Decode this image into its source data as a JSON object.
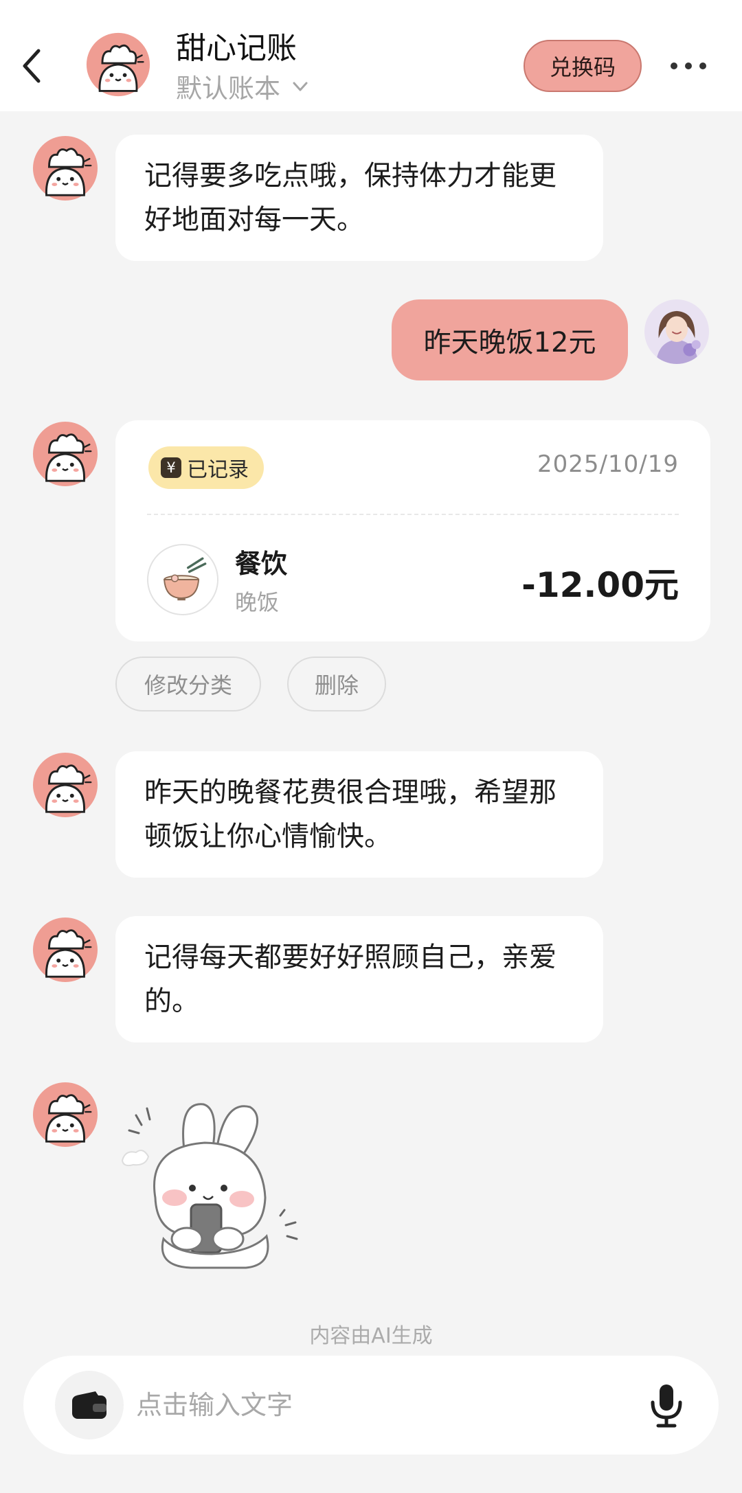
{
  "header": {
    "app_title": "甜心记账",
    "account_book": "默认账本",
    "redeem_label": "兑换码",
    "icons": [
      "chevron-left-icon",
      "chevron-down-icon",
      "more-icon"
    ]
  },
  "messages": [
    {
      "from": "bot",
      "text": "记得要多吃点哦，保持体力才能更好地面对每一天。"
    },
    {
      "from": "user",
      "text": "昨天晚饭12元"
    },
    {
      "from": "bot",
      "text": "昨天的晚餐花费很合理哦，希望那顿饭让你心情愉快。"
    },
    {
      "from": "bot",
      "text": "记得每天都要好好照顾自己，亲爱的。"
    }
  ],
  "record_card": {
    "badge_icon": "¥",
    "badge_label": "已记录",
    "date": "2025/10/19",
    "category": "餐饮",
    "subcategory": "晚饭",
    "amount": "-12.00元"
  },
  "record_actions": {
    "change_category": "修改分类",
    "delete": "删除"
  },
  "ai_note": "内容由AI生成",
  "input": {
    "placeholder": "点击输入文字"
  },
  "colors": {
    "accent_pink": "#f0a49c",
    "badge_yellow": "#fbe7a9",
    "background": "#f4f4f4"
  }
}
